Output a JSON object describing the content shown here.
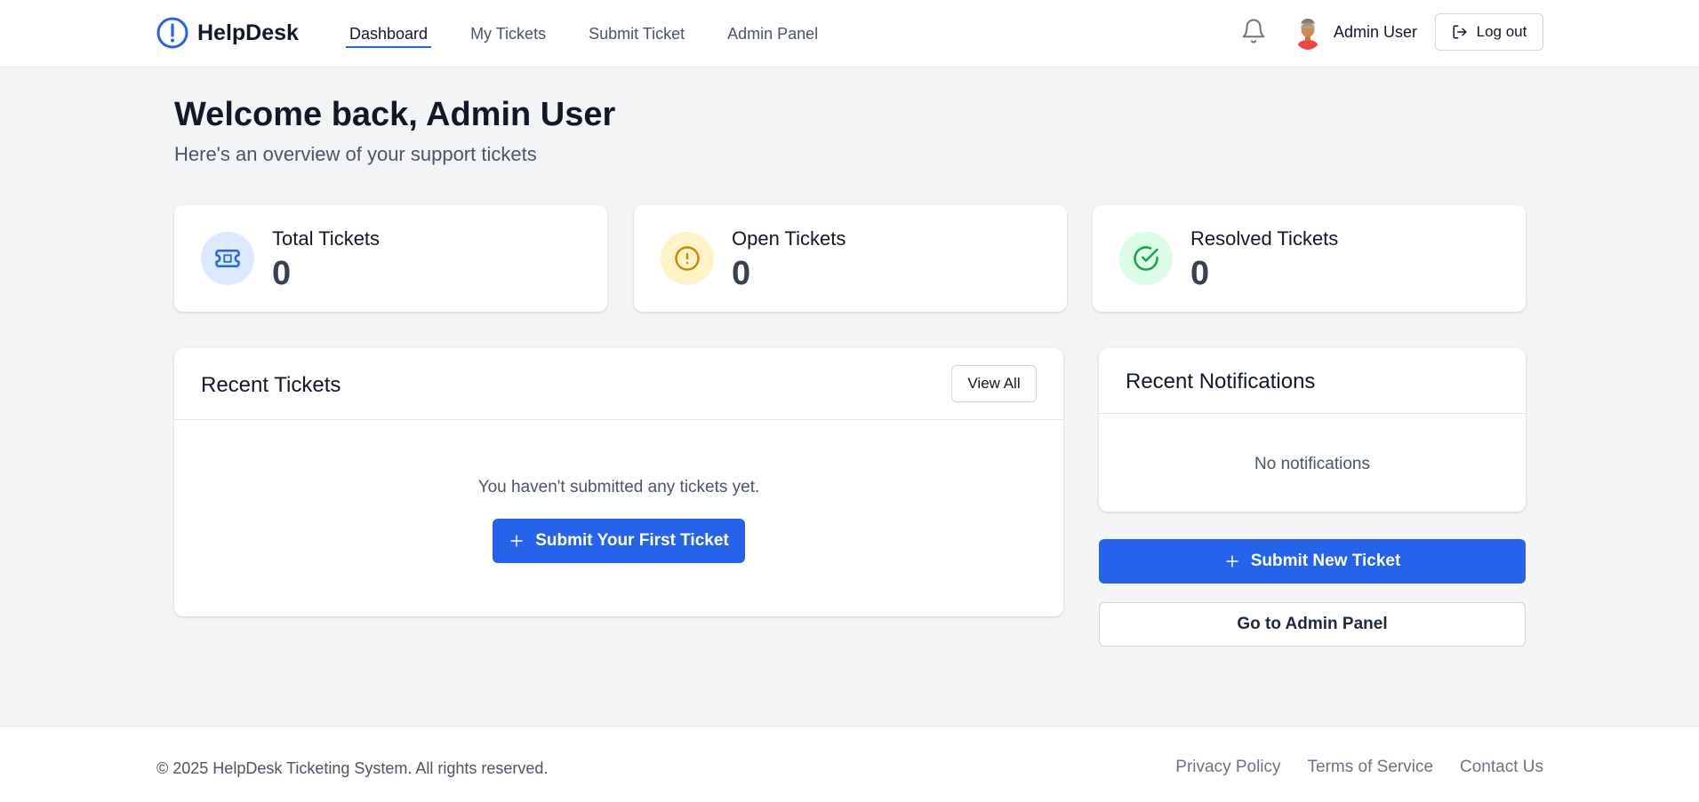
{
  "header": {
    "brand": "HelpDesk",
    "nav": [
      {
        "label": "Dashboard",
        "active": true
      },
      {
        "label": "My Tickets",
        "active": false
      },
      {
        "label": "Submit Ticket",
        "active": false
      },
      {
        "label": "Admin Panel",
        "active": false
      }
    ],
    "user_name": "Admin User",
    "logout_label": "Log out"
  },
  "welcome": {
    "title": "Welcome back, Admin User",
    "subtitle": "Here's an overview of your support tickets"
  },
  "stats": [
    {
      "label": "Total Tickets",
      "value": "0",
      "icon": "ticket-icon",
      "color": "#2563eb",
      "bg": "#dbeafe"
    },
    {
      "label": "Open Tickets",
      "value": "0",
      "icon": "alert-circle-icon",
      "color": "#ca8a04",
      "bg": "#fef3c7"
    },
    {
      "label": "Resolved Tickets",
      "value": "0",
      "icon": "check-circle-icon",
      "color": "#16a34a",
      "bg": "#dcfce7"
    }
  ],
  "recent_tickets": {
    "title": "Recent Tickets",
    "view_all_label": "View All",
    "empty_text": "You haven't submitted any tickets yet.",
    "submit_first_label": "Submit Your First Ticket"
  },
  "notifications": {
    "title": "Recent Notifications",
    "empty_text": "No notifications"
  },
  "actions": {
    "submit_new_label": "Submit New Ticket",
    "admin_panel_label": "Go to Admin Panel"
  },
  "footer": {
    "copyright": "© 2025 HelpDesk Ticketing System. All rights reserved.",
    "links": [
      "Privacy Policy",
      "Terms of Service",
      "Contact Us"
    ]
  },
  "colors": {
    "accent": "#2563eb",
    "page_bg": "#f3f4f6"
  }
}
